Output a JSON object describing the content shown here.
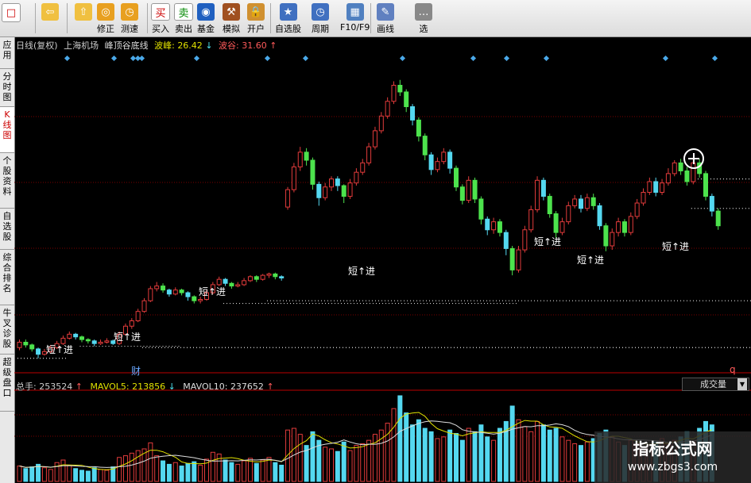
{
  "toolbar": {
    "buttons": [
      {
        "label": "",
        "icon": "logo-icon"
      },
      {
        "label": "",
        "icon": "back-arrow-icon"
      },
      {
        "label": "",
        "icon": "up-down-arrows-icon"
      },
      {
        "label": "修正",
        "icon": "refresh-icon"
      },
      {
        "label": "测速",
        "icon": "clock-icon"
      },
      {
        "label": "买入",
        "icon": "buy-icon",
        "glyph": "买"
      },
      {
        "label": "卖出",
        "icon": "sell-icon",
        "glyph": "卖"
      },
      {
        "label": "基金",
        "icon": "fund-icon"
      },
      {
        "label": "模拟",
        "icon": "gavel-icon"
      },
      {
        "label": "开户",
        "icon": "lock-icon"
      },
      {
        "label": "自选股",
        "icon": "star-icon"
      },
      {
        "label": "周期",
        "icon": "clock-icon"
      },
      {
        "label": "F10/F9",
        "icon": "table-icon"
      },
      {
        "label": "画线",
        "icon": "pencil-icon"
      },
      {
        "label": "选",
        "icon": "more-icon"
      }
    ]
  },
  "sidetabs": [
    {
      "label": "应用",
      "active": false
    },
    {
      "label": "分时图",
      "active": false
    },
    {
      "label": "K线图",
      "active": true
    },
    {
      "label": "个股资料",
      "active": false
    },
    {
      "label": "自选股",
      "active": false
    },
    {
      "label": "综合排名",
      "active": false
    },
    {
      "label": "牛叉诊股",
      "active": false
    },
    {
      "label": "超级盘口",
      "active": false
    }
  ],
  "info": {
    "period": "日线(复权)",
    "stock": "上海机场",
    "indicator": "峰顶谷底线",
    "peak_label": "波峰:",
    "peak_value": "26.42",
    "peak_arrow": "↓",
    "valley_label": "波谷:",
    "valley_value": "31.60",
    "valley_arrow": "↑"
  },
  "volume": {
    "total_label": "总手:",
    "total_value": "253524",
    "total_arrow": "↑",
    "mavol5_label": "MAVOL5:",
    "mavol5_value": "213856",
    "mavol5_arrow": "↓",
    "mavol10_label": "MAVOL10:",
    "mavol10_value": "237652",
    "mavol10_arrow": "↑",
    "selector": "成交量"
  },
  "signals": [
    {
      "text": "短↑进",
      "pos": "a"
    },
    {
      "text": "短↑进",
      "pos": "b"
    },
    {
      "text": "短↑进",
      "pos": "c"
    },
    {
      "text": "短↑进",
      "pos": "d"
    },
    {
      "text": "短↑进",
      "pos": "e"
    },
    {
      "text": "短↑进",
      "pos": "f"
    },
    {
      "text": "短↑进",
      "pos": "g"
    }
  ],
  "markers": {
    "cai": "财",
    "q": "q"
  },
  "watermark": {
    "title": "指标公式网",
    "url": "www.zbgs3.com"
  },
  "colors": {
    "up": "#e23b3b",
    "down": "#4de34d",
    "down_cyan": "#54d8f0",
    "grid": "#7a0000",
    "peak_text": "#e0e000",
    "valley_text": "#ff5a5a",
    "diamond": "#4aa8e8"
  },
  "chart_data": {
    "type": "candlestick",
    "title": "",
    "xlabel": "",
    "ylabel": "",
    "candles": [
      [
        34.0,
        34.4,
        34.6,
        33.8
      ],
      [
        34.4,
        34.2,
        34.6,
        34.0
      ],
      [
        34.2,
        33.9,
        34.3,
        33.7
      ],
      [
        33.9,
        33.5,
        34.0,
        33.2
      ],
      [
        33.5,
        33.7,
        33.9,
        33.4
      ],
      [
        33.7,
        34.0,
        34.2,
        33.6
      ],
      [
        34.0,
        34.3,
        34.5,
        33.9
      ],
      [
        34.3,
        34.7,
        34.9,
        34.2
      ],
      [
        34.7,
        35.0,
        35.2,
        34.6
      ],
      [
        35.0,
        34.8,
        35.1,
        34.6
      ],
      [
        34.8,
        34.6,
        34.9,
        34.4
      ],
      [
        34.6,
        34.5,
        34.7,
        34.3
      ],
      [
        34.5,
        34.3,
        34.6,
        34.1
      ],
      [
        34.3,
        34.4,
        34.6,
        34.2
      ],
      [
        34.4,
        34.5,
        34.7,
        34.3
      ],
      [
        34.5,
        34.3,
        34.6,
        34.2
      ],
      [
        34.3,
        35.0,
        35.2,
        34.2
      ],
      [
        35.0,
        35.6,
        35.8,
        34.9
      ],
      [
        35.6,
        36.0,
        36.2,
        35.4
      ],
      [
        36.0,
        36.7,
        36.9,
        35.9
      ],
      [
        36.7,
        37.5,
        37.7,
        36.6
      ],
      [
        37.5,
        38.4,
        38.6,
        37.4
      ],
      [
        38.4,
        38.6,
        38.9,
        38.2
      ],
      [
        38.6,
        38.3,
        38.8,
        38.1
      ],
      [
        38.3,
        38.0,
        38.4,
        37.8
      ],
      [
        38.0,
        38.3,
        38.5,
        37.9
      ],
      [
        38.3,
        38.1,
        38.4,
        37.9
      ],
      [
        38.1,
        37.8,
        38.2,
        37.5
      ],
      [
        37.8,
        37.5,
        37.9,
        37.3
      ],
      [
        37.5,
        37.6,
        37.8,
        37.3
      ],
      [
        37.6,
        38.1,
        38.3,
        37.5
      ],
      [
        38.1,
        38.7,
        38.9,
        38.0
      ],
      [
        38.7,
        39.1,
        39.3,
        38.6
      ],
      [
        39.1,
        38.8,
        39.2,
        38.6
      ],
      [
        38.8,
        38.6,
        38.9,
        38.4
      ],
      [
        38.6,
        38.7,
        38.9,
        38.5
      ],
      [
        38.7,
        39.0,
        39.2,
        38.6
      ],
      [
        39.0,
        39.3,
        39.4,
        38.9
      ],
      [
        39.3,
        39.1,
        39.4,
        38.9
      ],
      [
        39.1,
        39.4,
        39.5,
        39.0
      ],
      [
        39.4,
        39.5,
        39.6,
        39.2
      ],
      [
        39.5,
        39.3,
        39.6,
        39.1
      ],
      [
        39.3,
        39.2,
        39.4,
        39.0
      ],
      [
        44.5,
        45.8,
        46.0,
        44.3
      ],
      [
        45.8,
        47.5,
        47.8,
        45.6
      ],
      [
        47.5,
        48.6,
        49.0,
        47.2
      ],
      [
        48.6,
        48.0,
        48.9,
        47.6
      ],
      [
        48.0,
        46.2,
        48.2,
        45.8
      ],
      [
        46.2,
        45.2,
        46.4,
        44.6
      ],
      [
        45.2,
        46.0,
        46.3,
        45.0
      ],
      [
        46.0,
        46.6,
        46.8,
        45.7
      ],
      [
        46.6,
        46.1,
        46.8,
        45.7
      ],
      [
        46.1,
        45.3,
        46.2,
        44.8
      ],
      [
        45.3,
        46.3,
        46.6,
        45.1
      ],
      [
        46.3,
        47.1,
        47.4,
        46.1
      ],
      [
        47.1,
        47.8,
        48.1,
        46.9
      ],
      [
        47.8,
        49.0,
        49.3,
        47.6
      ],
      [
        49.0,
        50.2,
        50.5,
        48.8
      ],
      [
        50.2,
        51.3,
        51.6,
        50.0
      ],
      [
        51.3,
        52.4,
        52.7,
        51.1
      ],
      [
        52.4,
        53.6,
        53.9,
        52.2
      ],
      [
        53.6,
        53.1,
        54.0,
        52.8
      ],
      [
        53.1,
        52.0,
        53.3,
        51.6
      ],
      [
        52.0,
        51.0,
        52.2,
        50.6
      ],
      [
        51.0,
        49.8,
        51.2,
        49.4
      ],
      [
        49.8,
        48.4,
        50.0,
        48.0
      ],
      [
        48.4,
        47.3,
        48.6,
        46.9
      ],
      [
        47.3,
        47.9,
        48.2,
        47.1
      ],
      [
        47.9,
        48.6,
        48.9,
        47.7
      ],
      [
        48.6,
        47.4,
        48.8,
        47.0
      ],
      [
        47.4,
        46.0,
        47.6,
        45.7
      ],
      [
        46.0,
        45.0,
        46.2,
        44.7
      ],
      [
        45.0,
        46.5,
        46.8,
        44.8
      ],
      [
        46.5,
        45.1,
        46.7,
        44.8
      ],
      [
        45.1,
        43.6,
        45.3,
        43.2
      ],
      [
        43.6,
        42.8,
        43.8,
        42.4
      ],
      [
        42.8,
        43.4,
        43.7,
        42.5
      ],
      [
        43.4,
        42.6,
        43.6,
        42.3
      ],
      [
        42.6,
        41.4,
        42.8,
        40.9
      ],
      [
        41.4,
        39.8,
        41.6,
        39.4
      ],
      [
        39.8,
        41.3,
        41.6,
        39.6
      ],
      [
        41.3,
        42.8,
        43.1,
        41.1
      ],
      [
        42.8,
        44.3,
        44.6,
        42.6
      ],
      [
        44.3,
        46.5,
        46.8,
        44.1
      ],
      [
        46.5,
        45.3,
        46.7,
        45.0
      ],
      [
        45.3,
        44.0,
        45.5,
        43.7
      ],
      [
        44.0,
        42.6,
        44.2,
        42.2
      ],
      [
        42.6,
        43.4,
        43.7,
        42.4
      ],
      [
        43.4,
        44.6,
        44.9,
        43.2
      ],
      [
        44.6,
        45.1,
        45.4,
        44.4
      ],
      [
        45.1,
        44.4,
        45.4,
        44.1
      ],
      [
        44.4,
        45.2,
        45.5,
        44.2
      ],
      [
        45.2,
        44.6,
        45.5,
        44.3
      ],
      [
        44.6,
        43.1,
        44.8,
        42.8
      ],
      [
        43.1,
        41.6,
        43.3,
        41.2
      ],
      [
        41.6,
        42.6,
        42.9,
        41.3
      ],
      [
        42.6,
        43.4,
        43.7,
        42.3
      ],
      [
        43.4,
        42.6,
        43.6,
        42.3
      ],
      [
        42.6,
        43.8,
        44.1,
        42.4
      ],
      [
        43.8,
        44.8,
        45.1,
        43.6
      ],
      [
        44.8,
        45.6,
        45.9,
        44.6
      ],
      [
        45.6,
        46.4,
        46.7,
        45.4
      ],
      [
        46.4,
        45.6,
        46.7,
        45.3
      ],
      [
        45.6,
        46.3,
        46.6,
        45.4
      ],
      [
        46.3,
        47.0,
        47.4,
        46.1
      ],
      [
        47.0,
        47.8,
        48.0,
        46.8
      ],
      [
        47.8,
        47.2,
        48.1,
        46.9
      ],
      [
        47.2,
        46.4,
        47.5,
        46.1
      ],
      [
        46.4,
        47.8,
        48.2,
        46.2
      ],
      [
        47.8,
        47.0,
        48.1,
        46.7
      ],
      [
        47.0,
        45.3,
        47.2,
        45.0
      ],
      [
        45.3,
        44.2,
        45.5,
        43.8
      ],
      [
        44.2,
        43.1,
        44.4,
        42.8
      ]
    ],
    "peak_levels": [
      {
        "from": 107,
        "to": 126,
        "value": 46.6
      },
      {
        "from": 136,
        "to": 150,
        "value": 46.3
      }
    ],
    "valley_levels": [
      {
        "from": 0,
        "to": 8,
        "value": 33.2
      },
      {
        "from": 10,
        "to": 26,
        "value": 34.1
      },
      {
        "from": 20,
        "to": 160,
        "value": 34.0
      },
      {
        "from": 33,
        "to": 80,
        "value": 37.3
      },
      {
        "from": 40,
        "to": 120,
        "value": 37.5
      },
      {
        "from": 108,
        "to": 118,
        "value": 44.4
      },
      {
        "from": 121,
        "to": 150,
        "value": 43.2
      }
    ],
    "ylim": [
      32,
      56
    ],
    "volume": [
      0.18,
      0.15,
      0.17,
      0.2,
      0.16,
      0.14,
      0.22,
      0.25,
      0.19,
      0.15,
      0.13,
      0.12,
      0.16,
      0.14,
      0.13,
      0.17,
      0.28,
      0.3,
      0.33,
      0.36,
      0.38,
      0.45,
      0.3,
      0.24,
      0.2,
      0.22,
      0.18,
      0.21,
      0.23,
      0.19,
      0.26,
      0.34,
      0.32,
      0.25,
      0.22,
      0.2,
      0.24,
      0.27,
      0.21,
      0.25,
      0.28,
      0.22,
      0.19,
      0.6,
      0.62,
      0.55,
      0.42,
      0.58,
      0.48,
      0.4,
      0.38,
      0.35,
      0.46,
      0.36,
      0.42,
      0.44,
      0.48,
      0.55,
      0.6,
      0.68,
      0.85,
      1.0,
      0.8,
      0.66,
      0.72,
      0.62,
      0.58,
      0.5,
      0.52,
      0.6,
      0.56,
      0.48,
      0.62,
      0.58,
      0.66,
      0.52,
      0.48,
      0.62,
      0.7,
      0.88,
      0.72,
      0.64,
      0.58,
      0.7,
      0.66,
      0.6,
      0.62,
      0.52,
      0.48,
      0.44,
      0.42,
      0.46,
      0.5,
      0.56,
      0.6,
      0.52,
      0.46,
      0.42,
      0.48,
      0.44,
      0.4,
      0.42,
      0.46,
      0.5,
      0.44,
      0.48,
      0.52,
      0.58,
      0.46,
      0.62,
      0.7,
      0.66
    ],
    "volume_up": "derived"
  }
}
